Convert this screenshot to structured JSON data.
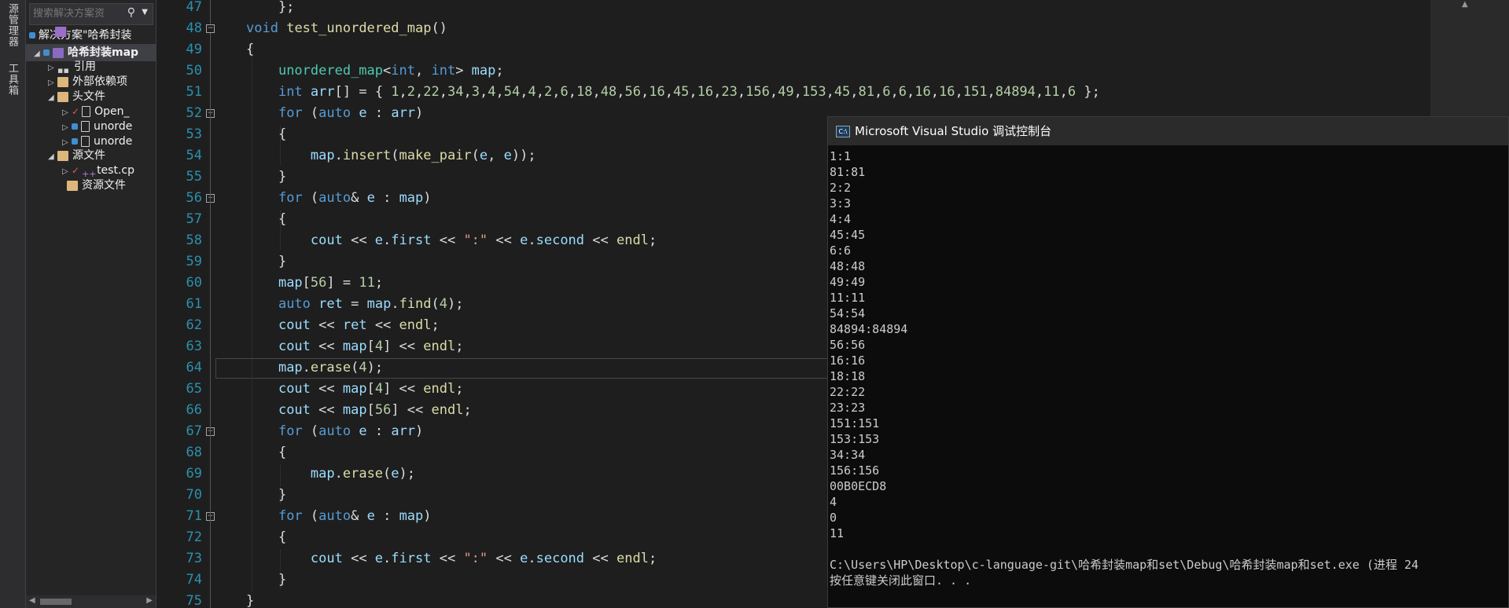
{
  "tool_strip": {
    "solution_explorer_tab": "源管理器",
    "toolbox_tab": "工具箱"
  },
  "solution_explorer": {
    "search_placeholder": "搜索解决方案资",
    "items": [
      {
        "label": "解决方案\"哈希封装",
        "indent": 0
      },
      {
        "label": "哈希封装map",
        "indent": 1
      },
      {
        "label": "引用",
        "indent": 2
      },
      {
        "label": "外部依赖项",
        "indent": 2
      },
      {
        "label": "头文件",
        "indent": 2
      },
      {
        "label": "Open_",
        "indent": 3
      },
      {
        "label": "unorde",
        "indent": 3
      },
      {
        "label": "unorde",
        "indent": 3
      },
      {
        "label": "源文件",
        "indent": 2
      },
      {
        "label": "test.cp",
        "indent": 3
      },
      {
        "label": "资源文件",
        "indent": 2
      }
    ]
  },
  "editor": {
    "line_numbers": [
      "47",
      "48",
      "49",
      "50",
      "51",
      "52",
      "53",
      "54",
      "55",
      "56",
      "57",
      "58",
      "59",
      "60",
      "61",
      "62",
      "63",
      "64",
      "65",
      "66",
      "67",
      "68",
      "69",
      "70",
      "71",
      "72",
      "73",
      "74",
      "75"
    ]
  },
  "console": {
    "title": "Microsoft Visual Studio 调试控制台",
    "lines": [
      "1:1",
      "81:81",
      "2:2",
      "3:3",
      "4:4",
      "45:45",
      "6:6",
      "48:48",
      "49:49",
      "11:11",
      "54:54",
      "84894:84894",
      "56:56",
      "16:16",
      "18:18",
      "22:22",
      "23:23",
      "151:151",
      "153:153",
      "34:34",
      "156:156",
      "00B0ECD8",
      "4",
      "0",
      "11",
      "",
      "C:\\Users\\HP\\Desktop\\c-language-git\\哈希封装map和set\\Debug\\哈希封装map和set.exe (进程 24",
      "按任意键关闭此窗口. . ."
    ]
  }
}
